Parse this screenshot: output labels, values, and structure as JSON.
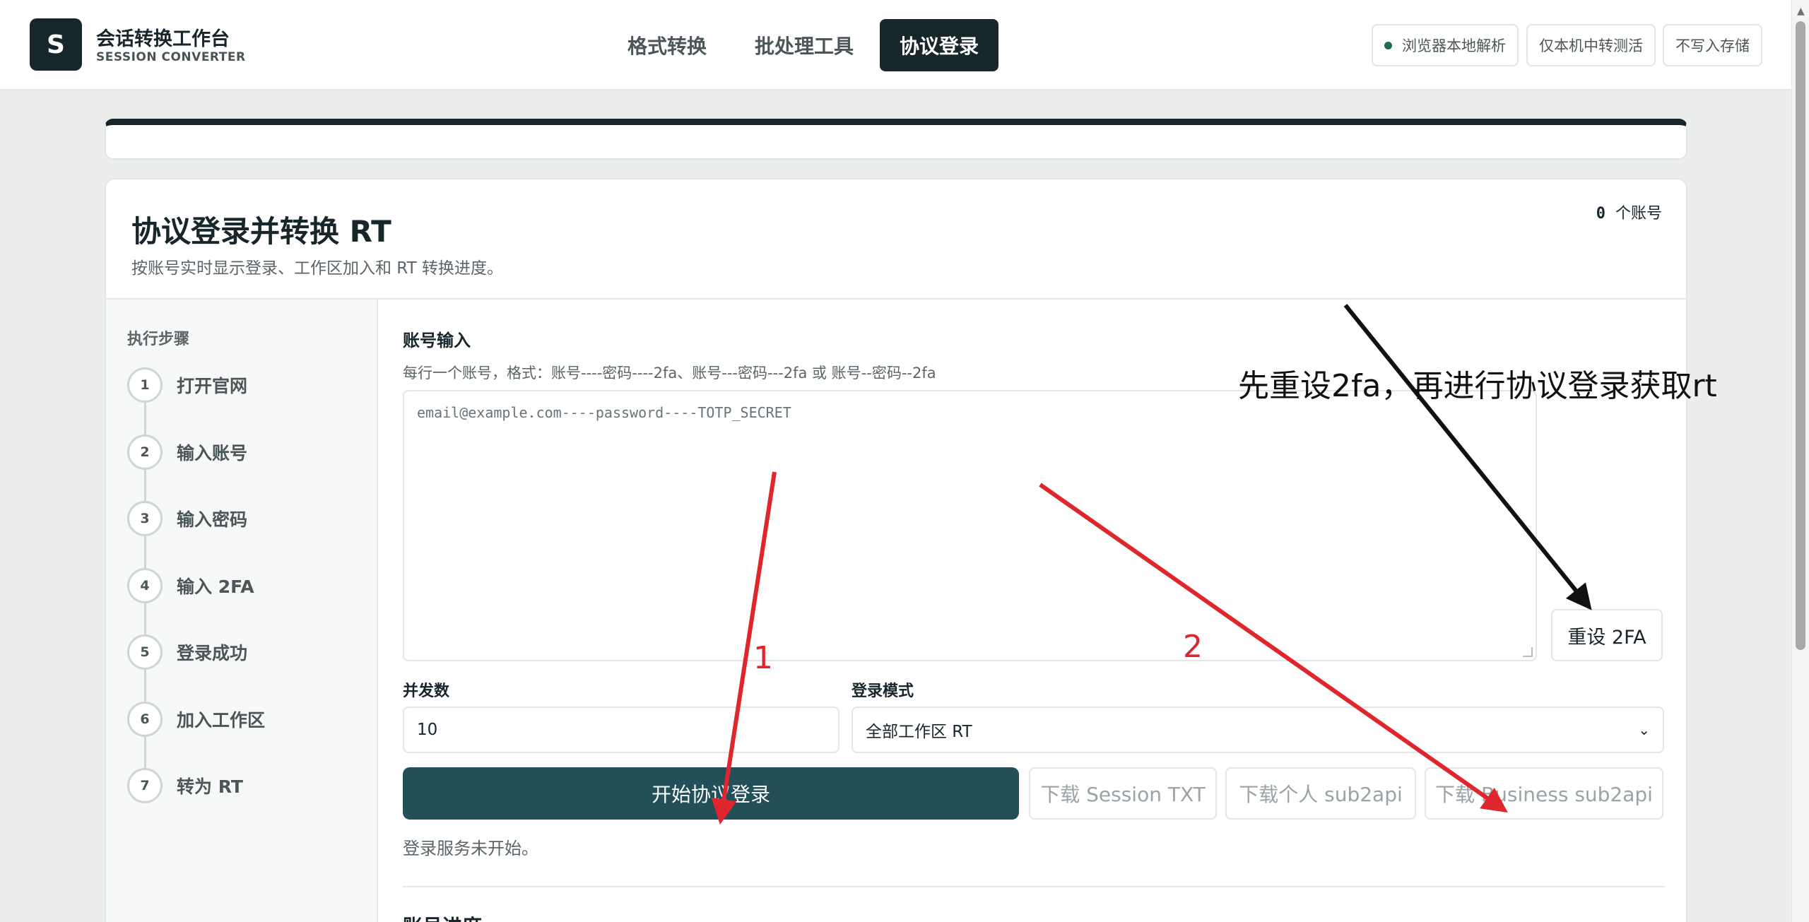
{
  "brand": {
    "logo": "S",
    "title": "会话转换工作台",
    "subtitle": "SESSION CONVERTER"
  },
  "nav": {
    "tabs": [
      {
        "label": "格式转换"
      },
      {
        "label": "批处理工具"
      },
      {
        "label": "协议登录",
        "active": true
      }
    ]
  },
  "pills": {
    "local_parse": "浏览器本地解析",
    "relay_test": "仅本机中转测活",
    "no_storage": "不写入存储"
  },
  "card": {
    "title": "协议登录并转换 RT",
    "subtitle": "按账号实时显示登录、工作区加入和 RT 转换进度。",
    "account_count": "0",
    "account_unit": "个账号"
  },
  "steps": {
    "title": "执行步骤",
    "items": [
      {
        "num": "1",
        "label": "打开官网"
      },
      {
        "num": "2",
        "label": "输入账号"
      },
      {
        "num": "3",
        "label": "输入密码"
      },
      {
        "num": "4",
        "label": "输入 2FA"
      },
      {
        "num": "5",
        "label": "登录成功"
      },
      {
        "num": "6",
        "label": "加入工作区"
      },
      {
        "num": "7",
        "label": "转为 RT"
      }
    ]
  },
  "form": {
    "accounts_label": "账号输入",
    "accounts_hint": "每行一个账号，格式：账号----密码----2fa、账号---密码---2fa 或 账号--密码--2fa",
    "accounts_placeholder": "email@example.com----password----TOTP_SECRET",
    "reset_2fa": "重设 2FA",
    "concurrency_label": "并发数",
    "concurrency_value": "10",
    "mode_label": "登录模式",
    "mode_value": "全部工作区 RT",
    "start_button": "开始协议登录",
    "download_session": "下载 Session TXT",
    "download_personal": "下载个人 sub2api",
    "download_business": "下载 Business sub2api",
    "status": "登录服务未开始。",
    "next_section": "账号进度"
  },
  "annotations": {
    "note": "先重设2fa，再进行协议登录获取rt",
    "num1": "1",
    "num2": "2",
    "colors": {
      "red": "#e0262d",
      "black": "#111111"
    }
  }
}
